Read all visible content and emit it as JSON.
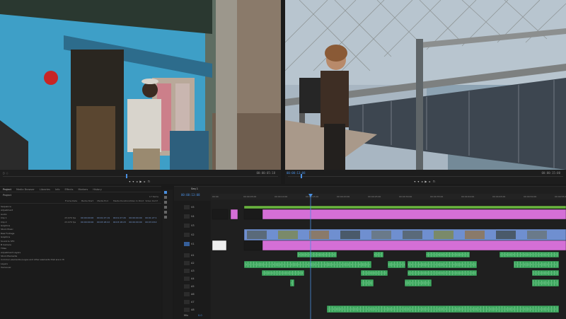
{
  "source_monitor": {
    "timecode_out": "00:00:05:18",
    "zoom": "Fit",
    "quality": "Full"
  },
  "program_monitor": {
    "timecode_in": "00:00:13:08",
    "timecode_out": "00:00:15:00",
    "zoom": "Fit",
    "quality": "Full"
  },
  "project_panel": {
    "tabs": [
      "Project",
      "Media Browser",
      "Libraries",
      "Info",
      "Effects",
      "Markers",
      "History"
    ],
    "active_tab": "Project",
    "bin_name": "Project",
    "item_count": "17 Items",
    "columns": [
      "Frame Rate",
      "Media Start",
      "Media End",
      "Media Duration",
      "Video In Point",
      "Video Out P"
    ],
    "rows": [
      {
        "name": "Sequence",
        "vals": [
          "",
          "",
          "",
          "",
          "",
          ""
        ]
      },
      {
        "name": "Adjustment",
        "vals": [
          "",
          "",
          "",
          "",
          "",
          ""
        ]
      },
      {
        "name": "Audio",
        "vals": [
          "",
          "",
          "",
          "",
          "",
          ""
        ]
      },
      {
        "name": "Clip 1",
        "vals": [
          "23.976 fps",
          "00:00:00:00",
          "00:01:27:19",
          "00:01:27:20",
          "00:00:00:00",
          "00:01:27:1"
        ]
      },
      {
        "name": "Clip 2",
        "vals": [
          "23.976 fps",
          "00:00:00:00",
          "00:03:18:22",
          "00:03:18:23",
          "00:00:00:00",
          "00:03:18:2"
        ]
      },
      {
        "name": "Graphics",
        "vals": [
          "",
          "",
          "",
          "",
          "",
          ""
        ]
      },
      {
        "name": "Stock Music",
        "vals": [
          "",
          "",
          "",
          "",
          "",
          ""
        ]
      },
      {
        "name": "Raw Footage",
        "vals": [
          "",
          "",
          "",
          "",
          "",
          ""
        ]
      },
      {
        "name": "Graphics",
        "vals": [
          "",
          "",
          "",
          "",
          "",
          ""
        ]
      },
      {
        "name": "Sound & SFX",
        "vals": [
          "",
          "",
          "",
          "",
          "",
          ""
        ]
      },
      {
        "name": "B Camera",
        "vals": [
          "",
          "",
          "",
          "",
          "",
          ""
        ]
      },
      {
        "name": "Titles",
        "vals": [
          "",
          "",
          "",
          "",
          "",
          ""
        ]
      },
      {
        "name": "Adjustment Layers",
        "vals": [
          "",
          "",
          "",
          "",
          "",
          ""
        ]
      },
      {
        "name": "Stock Elements",
        "vals": [
          "",
          "",
          "",
          "",
          "",
          ""
        ]
      },
      {
        "name": "Common elements (Logos and other elements that are in fini",
        "vals": [
          "",
          "",
          "",
          "",
          "",
          ""
        ]
      },
      {
        "name": "Layers",
        "vals": [
          "",
          "",
          "",
          "",
          "",
          ""
        ]
      },
      {
        "name": "Voiceover",
        "vals": [
          "",
          "",
          "",
          "",
          "",
          ""
        ]
      }
    ]
  },
  "timeline": {
    "sequence_tab": "Seq 1",
    "timecode": "00:00:13:08",
    "ruler_labels": [
      "00:00",
      "00:00:05:00",
      "00:00:10:00",
      "00:00:15:00",
      "00:00:20:00",
      "00:00:25:00",
      "00:00:30:00",
      "00:00:35:00",
      "00:00:40:00",
      "00:00:45:00",
      "00:00:50:00",
      "00:00:55:00"
    ],
    "video_tracks": [
      "V5",
      "V4",
      "V3",
      "V2",
      "V1"
    ],
    "audio_tracks": [
      "A1",
      "A2",
      "A3",
      "A4",
      "A5",
      "A6",
      "A7",
      "A8"
    ],
    "master_label": "Mix",
    "master_value": "0.0"
  },
  "colors": {
    "accent_blue": "#4a8fe0",
    "clip_magenta": "#d46fd6",
    "clip_green_audio": "#3ea75f",
    "clip_video_blue": "#6f8fd0",
    "adjust_green": "#69b33f"
  }
}
